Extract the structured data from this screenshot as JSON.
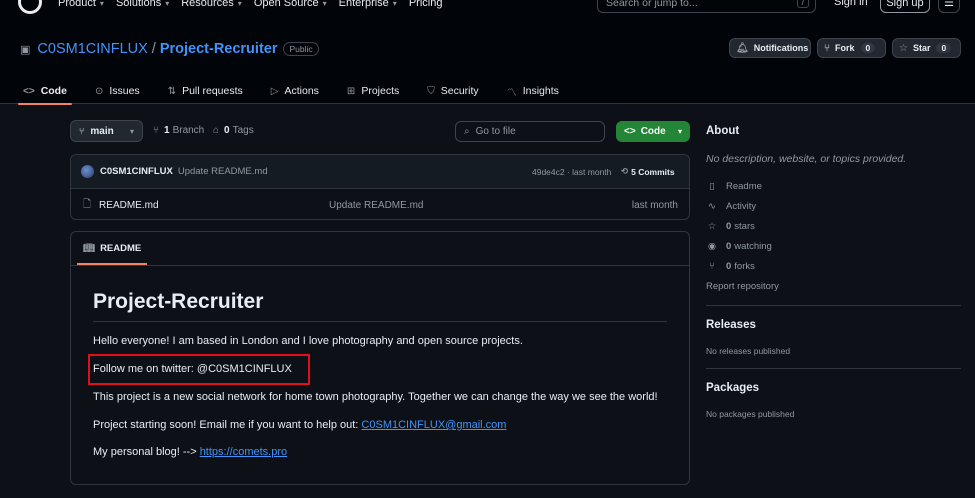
{
  "topnav": {
    "items": [
      "Product",
      "Solutions",
      "Resources",
      "Open Source",
      "Enterprise",
      "Pricing"
    ],
    "search_placeholder": "Search or jump to...",
    "search_shortcut": "/",
    "signin": "Sign in",
    "signup": "Sign up"
  },
  "repo": {
    "owner": "C0SM1CINFLUX",
    "separator": "/",
    "name": "Project-Recruiter",
    "visibility": "Public",
    "notifications_label": "Notifications",
    "fork_label": "Fork",
    "fork_count": "0",
    "star_label": "Star",
    "star_count": "0"
  },
  "tabs": [
    "Code",
    "Issues",
    "Pull requests",
    "Actions",
    "Projects",
    "Security",
    "Insights"
  ],
  "toolbar": {
    "branch": "main",
    "branch_count": "1",
    "branch_label": "Branch",
    "tag_count": "0",
    "tag_label": "Tags",
    "goto_placeholder": "Go to file",
    "code_label": "Code"
  },
  "latest_commit": {
    "author": "C0SM1CINFLUX",
    "message": "Update README.md",
    "hash": "49de4c2 · last month",
    "commits": "5 Commits"
  },
  "files": [
    {
      "name": "README.md",
      "message": "Update README.md",
      "date": "last month"
    }
  ],
  "readme": {
    "tab_label": "README",
    "title": "Project-Recruiter",
    "p1": "Hello everyone! I am based in London and I love photography and open source projects.",
    "p2": "Follow me on twitter: @C0SM1CINFLUX",
    "p3": "This project is a new social network for home town photography. Together we can change the way we see the world!",
    "p4_text": "Project starting soon! Email me if you want to help out: ",
    "p4_link": "C0SM1CINFLUX@gmail.com",
    "p5_text": "My personal blog! --> ",
    "p5_link": "https://comets.pro"
  },
  "about": {
    "heading": "About",
    "description": "No description, website, or topics provided.",
    "readme": "Readme",
    "activity": "Activity",
    "stars_count": "0",
    "stars_label": "stars",
    "watching_count": "0",
    "watching_label": "watching",
    "forks_count": "0",
    "forks_label": "forks",
    "report": "Report repository"
  },
  "releases": {
    "heading": "Releases",
    "empty": "No releases published"
  },
  "packages": {
    "heading": "Packages",
    "empty": "No packages published"
  },
  "colors": {
    "accent_link": "#4493f8",
    "code_button": "#238636",
    "tab_underline": "#f78166",
    "highlight_box": "#e0101a"
  }
}
